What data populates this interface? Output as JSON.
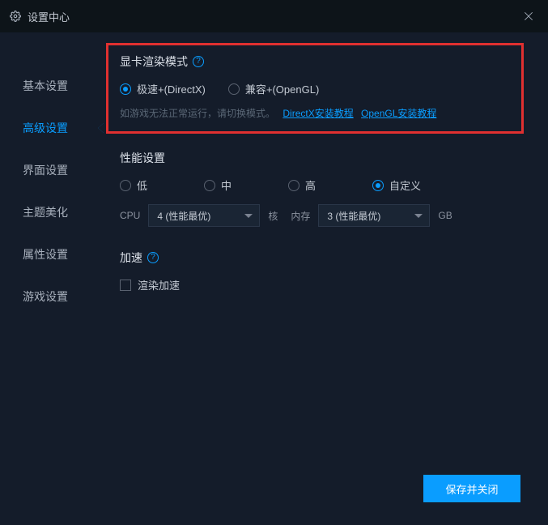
{
  "window": {
    "title": "设置中心"
  },
  "sidebar": {
    "items": [
      {
        "label": "基本设置"
      },
      {
        "label": "高级设置"
      },
      {
        "label": "界面设置"
      },
      {
        "label": "主题美化"
      },
      {
        "label": "属性设置"
      },
      {
        "label": "游戏设置"
      }
    ],
    "active_index": 1
  },
  "render_mode": {
    "title": "显卡渲染模式",
    "options": [
      {
        "label": "极速+(DirectX)",
        "checked": true
      },
      {
        "label": "兼容+(OpenGL)",
        "checked": false
      }
    ],
    "hint": "如游戏无法正常运行，请切换模式。",
    "link1": "DirectX安装教程",
    "link2": "OpenGL安装教程"
  },
  "performance": {
    "title": "性能设置",
    "options": [
      {
        "label": "低",
        "checked": false
      },
      {
        "label": "中",
        "checked": false
      },
      {
        "label": "高",
        "checked": false
      },
      {
        "label": "自定义",
        "checked": true
      }
    ],
    "cpu_label": "CPU",
    "cpu_value": "4 (性能最优)",
    "cores_label": "核",
    "mem_label": "内存",
    "mem_value": "3 (性能最优)",
    "gb_label": "GB"
  },
  "accel": {
    "title": "加速",
    "render_accel_label": "渲染加速",
    "render_accel_checked": false
  },
  "footer": {
    "save_label": "保存并关闭"
  }
}
